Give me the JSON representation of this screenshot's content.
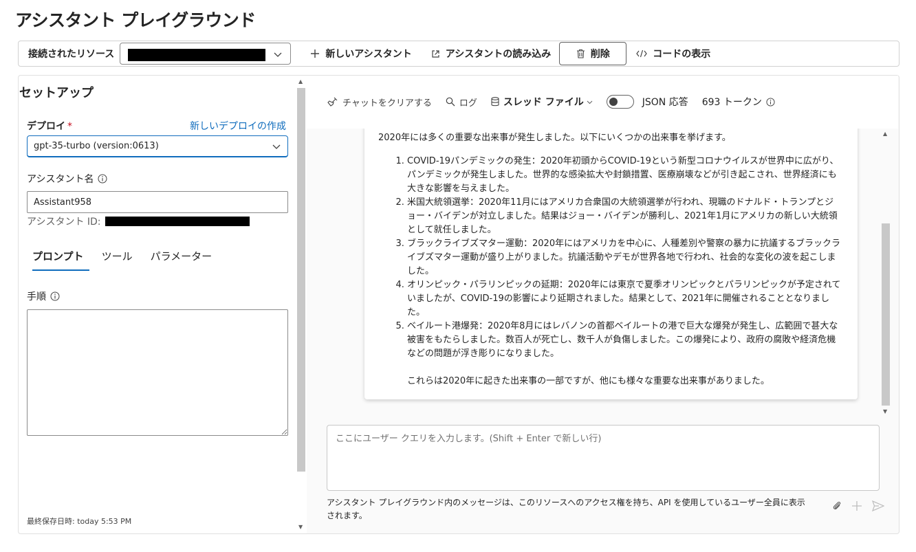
{
  "page": {
    "title": "アシスタント プレイグラウンド"
  },
  "toolbar": {
    "resource_label": "接続されたリソース",
    "new_assistant": "新しいアシスタント",
    "import_assistant": "アシスタントの読み込み",
    "delete": "削除",
    "view_code": "コードの表示"
  },
  "setup": {
    "title": "セットアップ",
    "deploy_label": "デプロイ",
    "required_mark": "*",
    "new_deploy_link": "新しいデプロイの作成",
    "deploy_value": "gpt-35-turbo (version:0613)",
    "name_label": "アシスタント名",
    "name_value": "Assistant958",
    "id_label": "アシスタント ID:",
    "tabs": [
      {
        "label": "プロンプト"
      },
      {
        "label": "ツール"
      },
      {
        "label": "パラメーター"
      }
    ],
    "instructions_label": "手順",
    "last_saved": "最終保存日時: today 5:53 PM"
  },
  "chat_header": {
    "clear_chat": "チャットをクリアする",
    "log": "ログ",
    "thread_files": "スレッド ファイル",
    "json_response": "JSON 応答",
    "tokens": "693 トークン"
  },
  "message": {
    "intro": "2020年には多くの重要な出来事が発生しました。以下にいくつかの出来事を挙げます。",
    "items": [
      "COVID-19パンデミックの発生：2020年初頭からCOVID-19という新型コロナウイルスが世界中に広がり、パンデミックが発生しました。世界的な感染拡大や封鎖措置、医療崩壊などが引き起こされ、世界経済にも大きな影響を与えました。",
      "米国大統領選挙：2020年11月にはアメリカ合衆国の大統領選挙が行われ、現職のドナルド・トランプとジョー・バイデンが対立しました。結果はジョー・バイデンが勝利し、2021年1月にアメリカの新しい大統領として就任しました。",
      "ブラックライブズマター運動：2020年にはアメリカを中心に、人種差別や警察の暴力に抗議するブラックライブズマター運動が盛り上がりました。抗議活動やデモが世界各地で行われ、社会的な変化の波を起こしました。",
      "オリンピック・パラリンピックの延期：2020年には東京で夏季オリンピックとパラリンピックが予定されていましたが、COVID-19の影響により延期されました。結果として、2021年に開催されることとなりました。",
      "ベイルート港爆発：2020年8月にはレバノンの首都ベイルートの港で巨大な爆発が発生し、広範囲で甚大な被害をもたらしました。数百人が死亡し、数千人が負傷しました。この爆発により、政府の腐敗や経済危機などの問題が浮き彫りになりました。"
    ],
    "outro": "これらは2020年に起きた出来事の一部ですが、他にも様々な重要な出来事がありました。"
  },
  "composer": {
    "placeholder": "ここにユーザー クエリを入力します。(Shift + Enter で新しい行)",
    "note": "アシスタント プレイグラウンド内のメッセージは、このリソースへのアクセス権を持ち、API を使用しているユーザー全員に表示されます。"
  }
}
